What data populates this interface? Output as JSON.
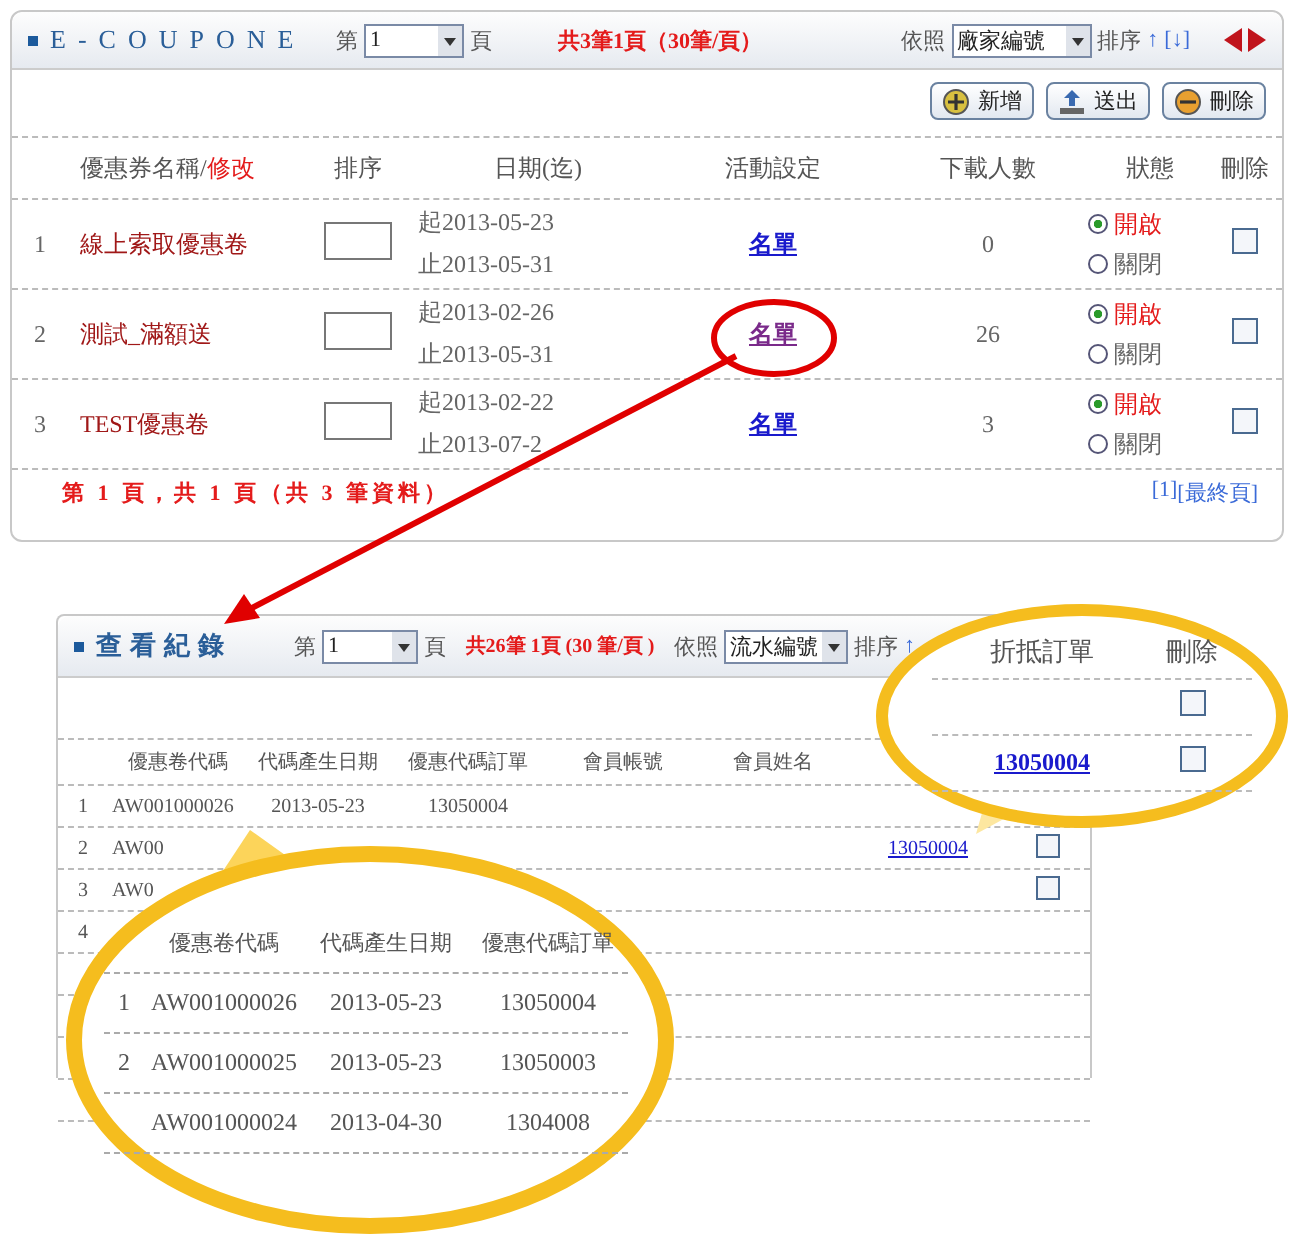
{
  "main_panel": {
    "title": "E-COUPONE",
    "page_before": "第",
    "page_value": "1",
    "page_after": "頁",
    "summary": "共3筆1頁（30筆/頁）",
    "sort_label": "依照",
    "sort_value": "廠家編號",
    "order_label": "排序",
    "order_asc": "↑",
    "order_desc": "[↓]",
    "buttons": [
      {
        "kind": "add",
        "label": "新增"
      },
      {
        "kind": "send",
        "label": "送出"
      },
      {
        "kind": "delete",
        "label": "刪除"
      }
    ],
    "name_column": {
      "label": "優惠券名稱/",
      "edit": "修改"
    },
    "columns": [
      "排序",
      "日期(迄)",
      "活動設定",
      "下載人數",
      "狀態",
      "刪除"
    ],
    "rows": [
      {
        "index": "1",
        "name": "線上索取優惠卷",
        "start": "起2013-05-23",
        "end": "止2013-05-31",
        "link": "名單",
        "visited": false,
        "circled": false,
        "downloads": "0",
        "status": [
          {
            "label": "開啟",
            "selected": true
          },
          {
            "label": "關閉",
            "selected": false
          }
        ],
        "checked": false
      },
      {
        "index": "2",
        "name": "測試_滿額送",
        "start": "起2013-02-26",
        "end": "止2013-05-31",
        "link": "名單",
        "visited": true,
        "circled": true,
        "downloads": "26",
        "status": [
          {
            "label": "開啟",
            "selected": true
          },
          {
            "label": "關閉",
            "selected": false
          }
        ],
        "checked": false
      },
      {
        "index": "3",
        "name": "TEST優惠卷",
        "start": "起2013-02-22",
        "end": "止2013-07-2",
        "link": "名單",
        "visited": false,
        "circled": false,
        "downloads": "3",
        "status": [
          {
            "label": "開啟",
            "selected": true
          },
          {
            "label": "關閉",
            "selected": false
          }
        ],
        "checked": false
      }
    ],
    "footer": "第 1 頁，共 1 頁（共 3 筆資料）",
    "pager": [
      "[1]",
      "[最終頁]"
    ]
  },
  "record_panel": {
    "title": "查看紀錄",
    "page_before": "第",
    "page_value": "1",
    "page_after": "頁",
    "summary": "共26筆 1頁 (30 筆/頁 )",
    "sort_label": "依照",
    "sort_value": "流水編號",
    "order_label": "排序",
    "order_asc": "↑",
    "columns": [
      "優惠卷代碼",
      "代碼產生日期",
      "優惠代碼訂單",
      "會員帳號",
      "會員姓名"
    ],
    "rows": [
      {
        "index": "1",
        "code": "AW001000026",
        "date": "2013-05-23",
        "order": "13050004"
      },
      {
        "index": "2",
        "code": "AW00",
        "discount_order": "13050004",
        "checked": false
      },
      {
        "index": "3",
        "code": "AW0",
        "checked": false
      },
      {
        "index": "4"
      }
    ]
  },
  "zoom_callouts": [
    {
      "kind": "column",
      "columns": [
        "折抵訂單",
        "刪除"
      ],
      "rows": [
        {
          "checked": false
        },
        {
          "link": "13050004",
          "checked": false
        }
      ]
    },
    {
      "kind": "table",
      "columns": [
        "優惠卷代碼",
        "代碼產生日期",
        "優惠代碼訂單"
      ],
      "rows": [
        {
          "index": "1",
          "code": "AW001000026",
          "date": "2013-05-23",
          "order": "13050004"
        },
        {
          "index": "2",
          "code": "AW001000025",
          "date": "2013-05-23",
          "order": "13050003"
        },
        {
          "code": "AW001000024",
          "date": "2013-04-30",
          "order": "1304008"
        }
      ]
    }
  ]
}
